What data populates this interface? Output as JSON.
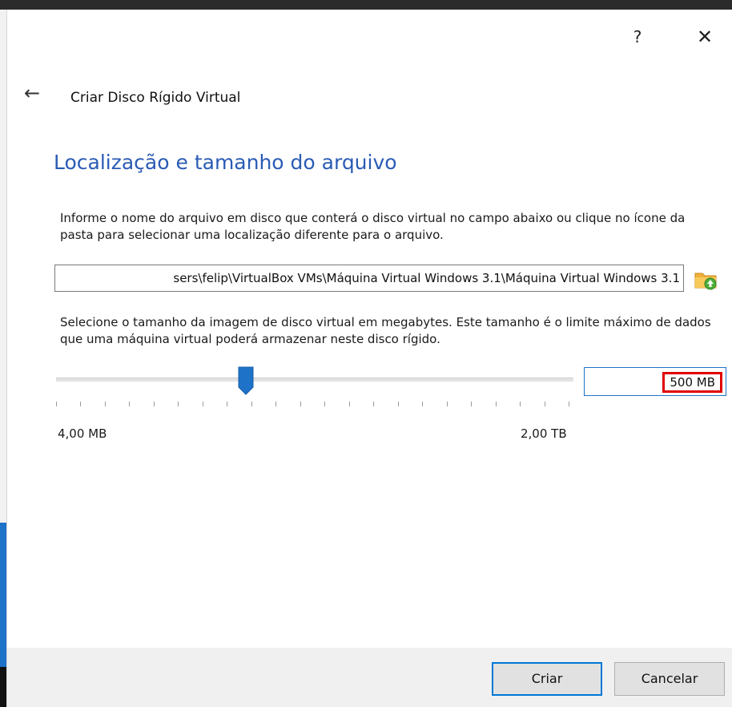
{
  "window": {
    "help_label": "?",
    "close_label": "✕"
  },
  "header": {
    "back_icon": "←",
    "title": "Criar Disco Rígido Virtual"
  },
  "section": {
    "heading": "Localização e tamanho do arquivo",
    "location_description": "Informe o nome do arquivo em disco que conterá o disco virtual no campo abaixo ou clique no ícone da pasta para selecionar uma localização diferente para o arquivo.",
    "file_path": "sers\\felip\\VirtualBox VMs\\Máquina Virtual Windows 3.1\\Máquina Virtual Windows 3.1",
    "size_description": "Selecione o tamanho da imagem de disco virtual em megabytes. Este tamanho é o limite máximo de dados que uma máquina virtual poderá armazenar neste disco rígido."
  },
  "size": {
    "value": "500 MB",
    "min_label": "4,00 MB",
    "max_label": "2,00 TB",
    "slider_fraction": 0.37
  },
  "buttons": {
    "create": "Criar",
    "cancel": "Cancelar"
  },
  "colors": {
    "heading": "#2a5bb5",
    "accent": "#0078d7",
    "highlight": "#e00000"
  },
  "icons": {
    "back": "arrow-left-icon",
    "folder": "folder-icon",
    "close": "close-icon",
    "help": "help-icon"
  }
}
